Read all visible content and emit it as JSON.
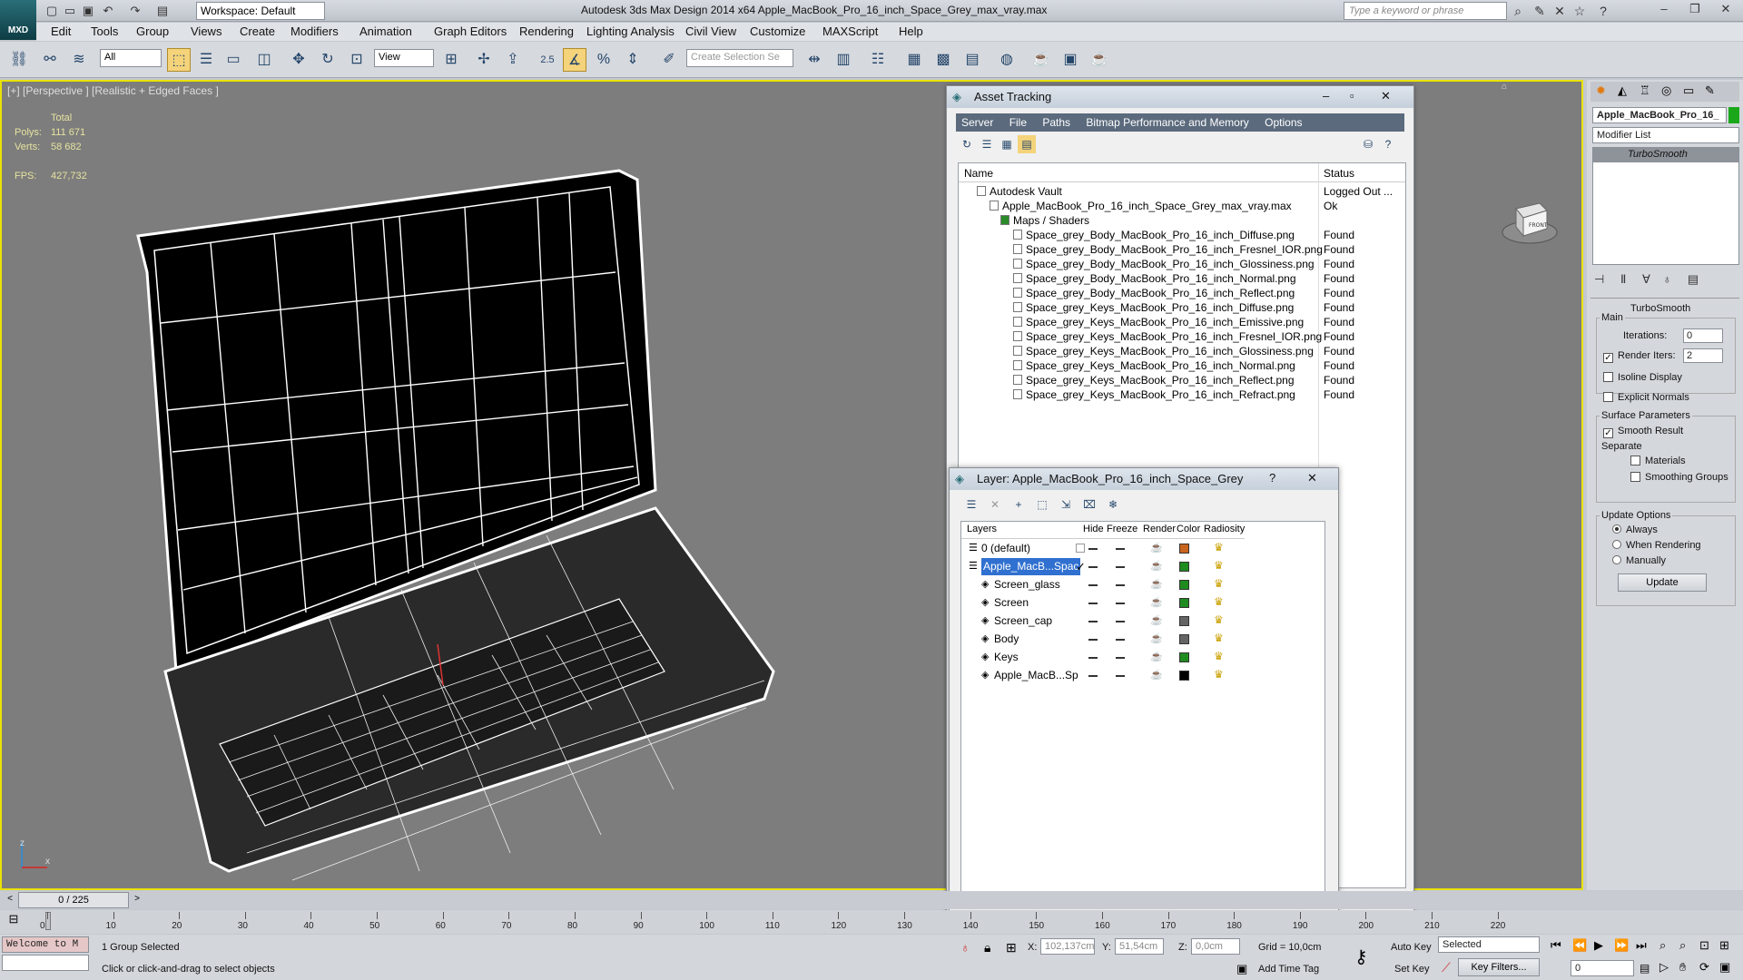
{
  "titlebar": {
    "logo": "MXD",
    "workspace": "Workspace: Default",
    "title": "Autodesk 3ds Max Design 2014 x64     Apple_MacBook_Pro_16_inch_Space_Grey_max_vray.max",
    "search_placeholder": "Type a keyword or phrase"
  },
  "menu": [
    "Edit",
    "Tools",
    "Group",
    "Views",
    "Create",
    "Modifiers",
    "Animation",
    "Graph Editors",
    "Rendering",
    "Lighting Analysis",
    "Civil View",
    "Customize",
    "MAXScript",
    "Help"
  ],
  "toolbar": {
    "filter": "All",
    "refcoord": "View",
    "snap_value": "2.5",
    "selection_set": "Create Selection Se"
  },
  "viewport": {
    "label": "[+] [Perspective ] [Realistic + Edged Faces ]",
    "stats": {
      "total_label": "Total",
      "polys_label": "Polys:",
      "polys": "111 671",
      "verts_label": "Verts:",
      "verts": "58 682",
      "fps_label": "FPS:",
      "fps": "427,732"
    },
    "viewcube_label": "FRONT",
    "axis_y": "z",
    "axis_x": "x"
  },
  "asset_tracking": {
    "title": "Asset Tracking",
    "menu": [
      "Server",
      "File",
      "Paths",
      "Bitmap Performance and Memory",
      "Options"
    ],
    "col_name": "Name",
    "col_status": "Status",
    "rows": [
      {
        "name": "Autodesk Vault",
        "status": "Logged Out ..."
      },
      {
        "name": "Apple_MacBook_Pro_16_inch_Space_Grey_max_vray.max",
        "status": "Ok"
      },
      {
        "name": "Maps / Shaders",
        "status": ""
      },
      {
        "name": "Space_grey_Body_MacBook_Pro_16_inch_Diffuse.png",
        "status": "Found"
      },
      {
        "name": "Space_grey_Body_MacBook_Pro_16_inch_Fresnel_IOR.png",
        "status": "Found"
      },
      {
        "name": "Space_grey_Body_MacBook_Pro_16_inch_Glossiness.png",
        "status": "Found"
      },
      {
        "name": "Space_grey_Body_MacBook_Pro_16_inch_Normal.png",
        "status": "Found"
      },
      {
        "name": "Space_grey_Body_MacBook_Pro_16_inch_Reflect.png",
        "status": "Found"
      },
      {
        "name": "Space_grey_Keys_MacBook_Pro_16_inch_Diffuse.png",
        "status": "Found"
      },
      {
        "name": "Space_grey_Keys_MacBook_Pro_16_inch_Emissive.png",
        "status": "Found"
      },
      {
        "name": "Space_grey_Keys_MacBook_Pro_16_inch_Fresnel_IOR.png",
        "status": "Found"
      },
      {
        "name": "Space_grey_Keys_MacBook_Pro_16_inch_Glossiness.png",
        "status": "Found"
      },
      {
        "name": "Space_grey_Keys_MacBook_Pro_16_inch_Normal.png",
        "status": "Found"
      },
      {
        "name": "Space_grey_Keys_MacBook_Pro_16_inch_Reflect.png",
        "status": "Found"
      },
      {
        "name": "Space_grey_Keys_MacBook_Pro_16_inch_Refract.png",
        "status": "Found"
      }
    ]
  },
  "layers": {
    "title": "Layer: Apple_MacBook_Pro_16_inch_Space_Grey",
    "cols": [
      "Layers",
      "Hide",
      "Freeze",
      "Render",
      "Color",
      "Radiosity"
    ],
    "rows": [
      {
        "name": "0 (default)",
        "color": "#c8641e"
      },
      {
        "name": "Apple_MacB...Spac",
        "color": "#1e8c1e"
      },
      {
        "name": "Screen_glass",
        "color": "#1e8c1e"
      },
      {
        "name": "Screen",
        "color": "#1e8c1e"
      },
      {
        "name": "Screen_cap",
        "color": "#646464"
      },
      {
        "name": "Body",
        "color": "#646464"
      },
      {
        "name": "Keys",
        "color": "#1e8c1e"
      },
      {
        "name": "Apple_MacB...Sp",
        "color": "#000000"
      }
    ]
  },
  "cmdpanel": {
    "object_name": "Apple_MacBook_Pro_16_",
    "modifier_list": "Modifier List",
    "stack_item": "TurboSmooth",
    "rollout": "TurboSmooth",
    "main": "Main",
    "iterations_label": "Iterations:",
    "iterations": "0",
    "render_iters_label": "Render Iters:",
    "render_iters": "2",
    "isoline": "Isoline Display",
    "explicit": "Explicit Normals",
    "surface": "Surface Parameters",
    "smooth_result": "Smooth Result",
    "separate": "Separate",
    "materials": "Materials",
    "smoothing_groups": "Smoothing Groups",
    "update_options": "Update Options",
    "always": "Always",
    "when_rendering": "When Rendering",
    "manually": "Manually",
    "update": "Update"
  },
  "timeline": {
    "frame": "0 / 225",
    "ticks": [
      "0",
      "10",
      "20",
      "30",
      "40",
      "50",
      "60",
      "70",
      "80",
      "90",
      "100",
      "110",
      "120",
      "130",
      "140",
      "150",
      "160",
      "170",
      "180",
      "190",
      "200",
      "210",
      "220"
    ]
  },
  "status": {
    "maxscript": "Welcome to M",
    "selected": "1 Group Selected",
    "prompt": "Click or click-and-drag to select objects",
    "x_label": "X:",
    "x": "102,137cm",
    "y_label": "Y:",
    "y": "51,54cm",
    "z_label": "Z:",
    "z": "0,0cm",
    "grid": "Grid = 10,0cm",
    "add_time_tag": "Add Time Tag",
    "auto_key": "Auto Key",
    "set_key": "Set Key",
    "key_mode": "Selected",
    "key_filters": "Key Filters...",
    "frame_field": "0"
  }
}
